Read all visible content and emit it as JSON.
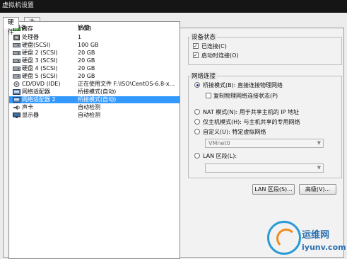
{
  "window": {
    "title": "虚拟机设置"
  },
  "tabs": [
    {
      "label": "硬件",
      "active": true
    },
    {
      "label": "选项",
      "active": false
    }
  ],
  "device_list": {
    "headers": {
      "device": "设备",
      "summary": "摘要"
    },
    "rows": [
      {
        "icon": "memory-icon",
        "name": "内存",
        "summary": "1 GB",
        "selected": false
      },
      {
        "icon": "cpu-icon",
        "name": "处理器",
        "summary": "1",
        "selected": false
      },
      {
        "icon": "hard-disk-icon",
        "name": "硬盘(SCSI)",
        "summary": "100 GB",
        "selected": false
      },
      {
        "icon": "hard-disk-icon",
        "name": "硬盘 2 (SCSI)",
        "summary": "20 GB",
        "selected": false
      },
      {
        "icon": "hard-disk-icon",
        "name": "硬盘 3 (SCSI)",
        "summary": "20 GB",
        "selected": false
      },
      {
        "icon": "hard-disk-icon",
        "name": "硬盘 4 (SCSI)",
        "summary": "20 GB",
        "selected": false
      },
      {
        "icon": "hard-disk-icon",
        "name": "硬盘 5 (SCSI)",
        "summary": "20 GB",
        "selected": false
      },
      {
        "icon": "cd-dvd-icon",
        "name": "CD/DVD (IDE)",
        "summary": "正在使用文件 F:\\ISO\\CentOS-6.8-x...",
        "selected": false
      },
      {
        "icon": "network-adapter-icon",
        "name": "网络适配器",
        "summary": "桥接模式(自动)",
        "selected": false
      },
      {
        "icon": "network-adapter-icon",
        "name": "网络适配器 2",
        "summary": "桥接模式(自动)",
        "selected": true
      },
      {
        "icon": "sound-card-icon",
        "name": "声卡",
        "summary": "自动检测",
        "selected": false
      },
      {
        "icon": "display-icon",
        "name": "显示器",
        "summary": "自动检测",
        "selected": false
      }
    ]
  },
  "device_status": {
    "title": "设备状态",
    "connected": {
      "label": "已连接(C)",
      "checked": true
    },
    "connect_at_power_on": {
      "label": "启动时连接(O)",
      "checked": true
    }
  },
  "network_connection": {
    "title": "网络连接",
    "bridged": {
      "label": "桥接模式(B): 直接连接物理网络",
      "selected": true
    },
    "replicate_state": {
      "label": "复制物理网络连接状态(P)",
      "checked": false
    },
    "nat": {
      "label": "NAT 模式(N): 用于共享主机的 IP 地址",
      "selected": false
    },
    "host_only": {
      "label": "仅主机模式(H): 与主机共享的专用网络",
      "selected": false
    },
    "custom": {
      "label": "自定义(U): 特定虚拟网络",
      "selected": false
    },
    "custom_select_value": "VMnet0",
    "lan_segment": {
      "label": "LAN 区段(L):",
      "selected": false
    },
    "lan_select_value": ""
  },
  "buttons": {
    "lan_segments": "LAN 区段(S)...",
    "advanced": "高级(V)..."
  },
  "watermark": {
    "text1": "运维网",
    "text2": "iyunv.com"
  },
  "colors": {
    "selection": "#3399ff",
    "radio_dot": "#1a2f8a",
    "watermark_blue": "#2a6fb0",
    "watermark_orange": "#f08b1f"
  }
}
